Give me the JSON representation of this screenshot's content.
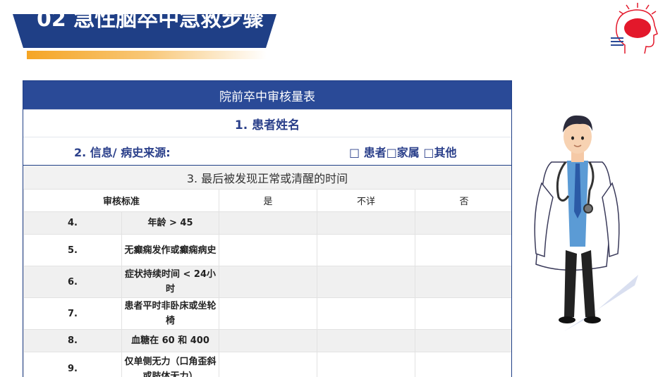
{
  "title": {
    "number": "02",
    "text": "急性脑卒中急救步骤"
  },
  "table": {
    "header": "院前卒中审核量表",
    "patient_name": "1. 患者姓名",
    "info_source_label": "2. 信息/ 病史来源:",
    "info_source_options": "□ 患者□家属 □其他",
    "last_normal_time": "3. 最后被发现正常或清醒的时间",
    "columns": [
      "审核标准",
      "是",
      "不详",
      "否"
    ],
    "rows": [
      {
        "num": "4.",
        "criterion": "年龄 > 45"
      },
      {
        "num": "5.",
        "criterion": "无癫痫发作或癫痫病史"
      },
      {
        "num": "6.",
        "criterion": "症状持续时间 < 24小时"
      },
      {
        "num": "7.",
        "criterion": "患者平时非卧床或坐轮椅"
      },
      {
        "num": "8.",
        "criterion": "血糖在 60 和 400"
      },
      {
        "num": "9.",
        "criterion": "仅单侧无力（口角歪斜或肢体无力）"
      }
    ]
  },
  "colors": {
    "brand_blue": "#1f3f86",
    "accent_orange": "#f5a524",
    "alert_red": "#e3182b"
  },
  "icons": {
    "head": "head-alert-icon",
    "menu": "menu-icon"
  }
}
